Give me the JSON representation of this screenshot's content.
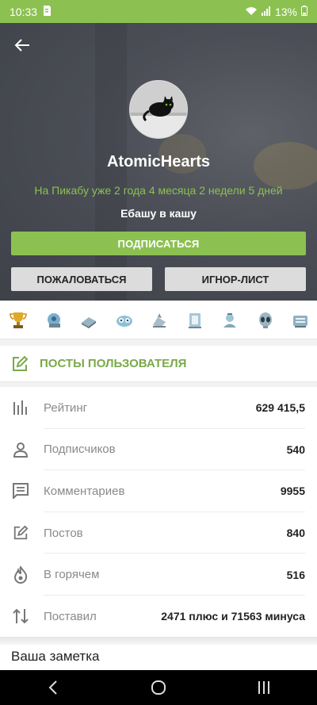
{
  "status_bar": {
    "time": "10:33",
    "battery": "13%"
  },
  "profile": {
    "username": "AtomicHearts",
    "since": "На Пикабу уже 2 года 4 месяца 2 недели 5 дней",
    "motto": "Ебашу в кашу",
    "subscribe_label": "ПОДПИСАТЬСЯ",
    "report_label": "ПОЖАЛОВАТЬСЯ",
    "ignore_label": "ИГНОР-ЛИСТ"
  },
  "awards": [
    "trophy-award-icon",
    "award-2-icon",
    "award-3-icon",
    "award-4-icon",
    "award-5-icon",
    "award-6-icon",
    "award-7-icon",
    "alien-award-icon",
    "award-9-icon"
  ],
  "posts_link": {
    "label": "ПОСТЫ ПОЛЬЗОВАТЕЛЯ"
  },
  "stats": [
    {
      "icon": "rating-bars-icon",
      "label": "Рейтинг",
      "value": "629 415,5"
    },
    {
      "icon": "person-icon",
      "label": "Подписчиков",
      "value": "540"
    },
    {
      "icon": "comment-icon",
      "label": "Комментариев",
      "value": "9955"
    },
    {
      "icon": "edit-icon",
      "label": "Постов",
      "value": "840"
    },
    {
      "icon": "fire-icon",
      "label": "В горячем",
      "value": "516"
    },
    {
      "icon": "updown-arrows-icon",
      "label": "Поставил",
      "value": "2471 плюс и 71563 минуса"
    }
  ],
  "note": {
    "label": "Ваша заметка"
  },
  "colors": {
    "accent": "#8cc152",
    "header_bg": "#4c4f57"
  }
}
